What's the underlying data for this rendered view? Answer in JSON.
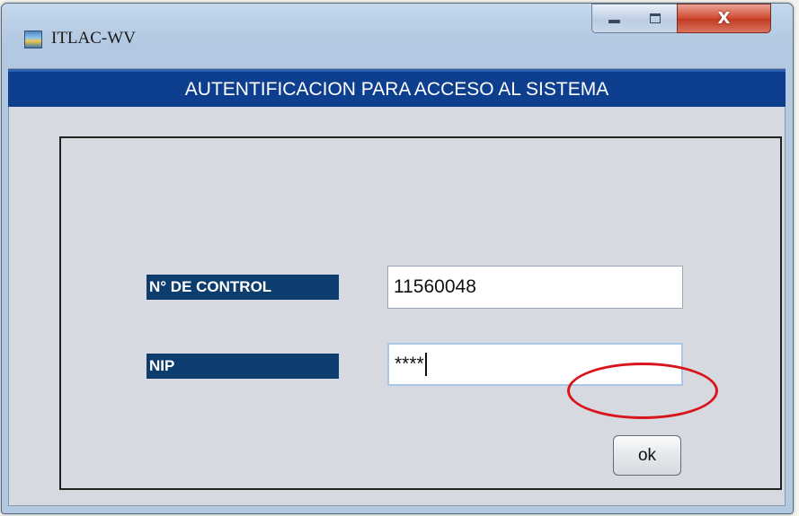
{
  "window": {
    "title": "ITLAC-WV",
    "close_glyph": "X",
    "app_icon": "app-icon",
    "accent_color": "#0e3f8f"
  },
  "banner": {
    "text": "AUTENTIFICACION PARA ACCESO AL SISTEMA"
  },
  "form": {
    "control_label": "N° DE CONTROL",
    "control_value": "11560048",
    "nip_label": "NIP",
    "nip_value": "****",
    "ok_label": "ok"
  },
  "annotation": {
    "highlight_color": "#d9141b"
  }
}
